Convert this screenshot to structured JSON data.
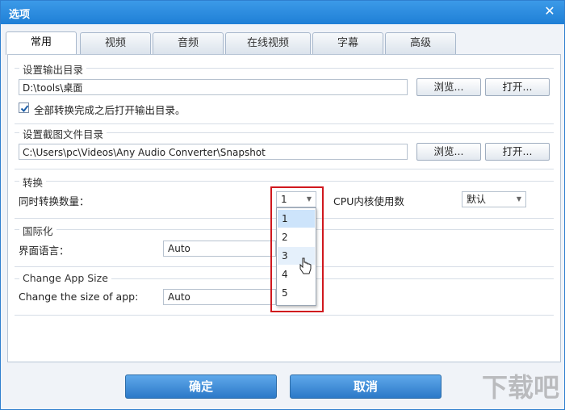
{
  "window": {
    "title": "选项",
    "close_glyph": "✕"
  },
  "tabs": [
    {
      "label": "常用"
    },
    {
      "label": "视频"
    },
    {
      "label": "音频"
    },
    {
      "label": "在线视频"
    },
    {
      "label": "字幕"
    },
    {
      "label": "高级"
    }
  ],
  "output_dir": {
    "title": "设置输出目录",
    "path": "D:\\tools\\桌面",
    "browse": "浏览...",
    "open": "打开...",
    "checkbox_label": "全部转换完成之后打开输出目录。",
    "checked": true
  },
  "snapshot_dir": {
    "title": "设置截图文件目录",
    "path": "C:\\Users\\pc\\Videos\\Any Audio Converter\\Snapshot",
    "browse": "浏览...",
    "open": "打开..."
  },
  "convert": {
    "title": "转换",
    "simul_label": "同时转换数量：",
    "simul_value": "1",
    "cpu_label": "CPU内核使用数",
    "cpu_value": "默认"
  },
  "dropdown_options": [
    "1",
    "2",
    "3",
    "4",
    "5"
  ],
  "i18n": {
    "title": "国际化",
    "lang_label": "界面语言：",
    "lang_value": "Auto"
  },
  "app_size": {
    "title": "Change App Size",
    "size_label": "Change the size of app:",
    "size_value": "Auto"
  },
  "footer": {
    "ok": "确定",
    "cancel": "取消"
  },
  "watermark": "下载吧",
  "colors": {
    "title_bar": "#1f7fd6",
    "highlight_box": "#d0181e"
  }
}
